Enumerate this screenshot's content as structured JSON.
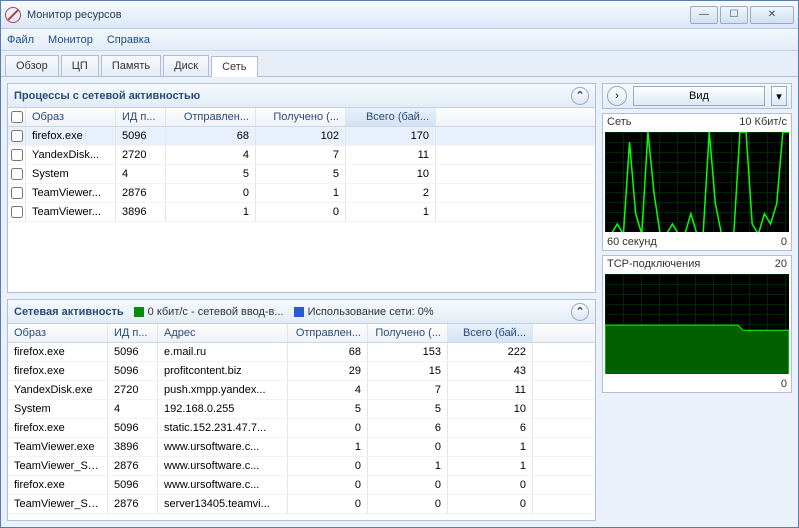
{
  "window": {
    "title": "Монитор ресурсов"
  },
  "menu": {
    "file": "Файл",
    "monitor": "Монитор",
    "help": "Справка"
  },
  "tabs": {
    "overview": "Обзор",
    "cpu": "ЦП",
    "memory": "Память",
    "disk": "Диск",
    "network": "Сеть"
  },
  "panel1": {
    "title": "Процессы с сетевой активностью",
    "cols": {
      "image": "Образ",
      "pid": "ИД п...",
      "sent": "Отправлен...",
      "recv": "Получено (...",
      "total": "Всего (бай..."
    },
    "rows": [
      {
        "img": "firefox.exe",
        "pid": "5096",
        "sent": "68",
        "recv": "102",
        "total": "170"
      },
      {
        "img": "YandexDisk...",
        "pid": "2720",
        "sent": "4",
        "recv": "7",
        "total": "11"
      },
      {
        "img": "System",
        "pid": "4",
        "sent": "5",
        "recv": "5",
        "total": "10"
      },
      {
        "img": "TeamViewer...",
        "pid": "2876",
        "sent": "0",
        "recv": "1",
        "total": "2"
      },
      {
        "img": "TeamViewer...",
        "pid": "3896",
        "sent": "1",
        "recv": "0",
        "total": "1"
      }
    ]
  },
  "panel2": {
    "title": "Сетевая активность",
    "legend1": "0 кбит/с - сетевой ввод-в...",
    "legend2": "Использование сети: 0%",
    "cols": {
      "image": "Образ",
      "pid": "ИД п...",
      "addr": "Адрес",
      "sent": "Отправлен...",
      "recv": "Получено (...",
      "total": "Всего (бай..."
    },
    "rows": [
      {
        "img": "firefox.exe",
        "pid": "5096",
        "addr": "e.mail.ru",
        "sent": "68",
        "recv": "153",
        "total": "222"
      },
      {
        "img": "firefox.exe",
        "pid": "5096",
        "addr": "profitcontent.biz",
        "sent": "29",
        "recv": "15",
        "total": "43"
      },
      {
        "img": "YandexDisk.exe",
        "pid": "2720",
        "addr": "push.xmpp.yandex...",
        "sent": "4",
        "recv": "7",
        "total": "11"
      },
      {
        "img": "System",
        "pid": "4",
        "addr": "192.168.0.255",
        "sent": "5",
        "recv": "5",
        "total": "10"
      },
      {
        "img": "firefox.exe",
        "pid": "5096",
        "addr": "static.152.231.47.7...",
        "sent": "0",
        "recv": "6",
        "total": "6"
      },
      {
        "img": "TeamViewer.exe",
        "pid": "3896",
        "addr": "www.ursoftware.c...",
        "sent": "1",
        "recv": "0",
        "total": "1"
      },
      {
        "img": "TeamViewer_Se...",
        "pid": "2876",
        "addr": "www.ursoftware.c...",
        "sent": "0",
        "recv": "1",
        "total": "1"
      },
      {
        "img": "firefox.exe",
        "pid": "5096",
        "addr": "www.ursoftware.c...",
        "sent": "0",
        "recv": "0",
        "total": "0"
      },
      {
        "img": "TeamViewer_Se...",
        "pid": "2876",
        "addr": "server13405.teamvi...",
        "sent": "0",
        "recv": "0",
        "total": "0"
      }
    ]
  },
  "right": {
    "view": "Вид",
    "g1": {
      "title": "Сеть",
      "scale": "10 Кбит/с",
      "xmin": "60 секунд",
      "xmax": "0"
    },
    "g2": {
      "title": "TCP-подключения",
      "scale": "20",
      "xmax": "0"
    }
  },
  "chart_data": [
    {
      "type": "line",
      "title": "Сеть",
      "ylabel": "Кбит/с",
      "ylim": [
        0,
        10
      ],
      "xlabel": "секунд",
      "xlim": [
        60,
        0
      ],
      "series": [
        {
          "name": "network",
          "values": [
            0,
            0,
            1,
            0,
            9,
            2,
            0,
            10,
            4,
            0,
            0,
            1,
            0,
            0,
            2,
            0,
            0,
            10,
            3,
            0,
            0,
            0,
            10,
            10,
            1,
            0,
            2,
            1,
            3,
            10
          ]
        }
      ]
    },
    {
      "type": "line",
      "title": "TCP-подключения",
      "ylim": [
        0,
        20
      ],
      "xlim": [
        60,
        0
      ],
      "series": [
        {
          "name": "tcp",
          "values": [
            10,
            10,
            10,
            10,
            10,
            10,
            10,
            10,
            10,
            10,
            10,
            10,
            10,
            10,
            10,
            10,
            10,
            10,
            10,
            10,
            10,
            10,
            10,
            9,
            9,
            9,
            9,
            9,
            9,
            9
          ]
        }
      ]
    }
  ]
}
